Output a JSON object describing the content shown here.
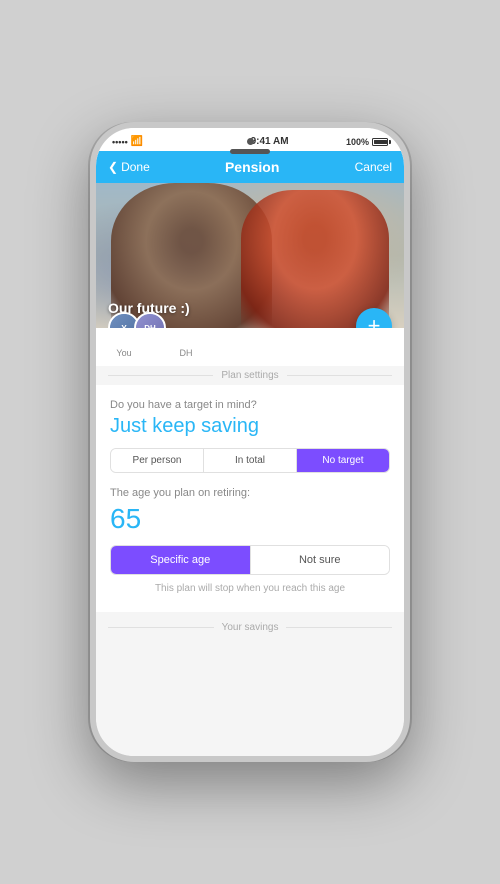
{
  "phone": {
    "status": {
      "signal_dots": "•••••",
      "wifi": "WiFi",
      "time": "9:41 AM",
      "battery_pct": "100%"
    },
    "nav": {
      "back_label": "Done",
      "title": "Pension",
      "cancel_label": "Cancel"
    },
    "hero": {
      "title": "Our future :)"
    },
    "avatars": [
      {
        "label": "You",
        "initials": "Y"
      },
      {
        "label": "DH",
        "initials": "DH"
      }
    ],
    "add_button_label": "+",
    "plan_settings_divider": "Plan settings",
    "question": "Do you have a target in mind?",
    "saving_value": "Just keep saving",
    "target_options": [
      {
        "label": "Per person",
        "active": false
      },
      {
        "label": "In total",
        "active": false
      },
      {
        "label": "No target",
        "active": true
      }
    ],
    "retire_question": "The age you plan on retiring:",
    "retire_age": "65",
    "age_options": [
      {
        "label": "Specific age",
        "active": true
      },
      {
        "label": "Not sure",
        "active": false
      }
    ],
    "age_hint": "This plan will stop when you reach this age",
    "savings_divider": "Your savings"
  }
}
